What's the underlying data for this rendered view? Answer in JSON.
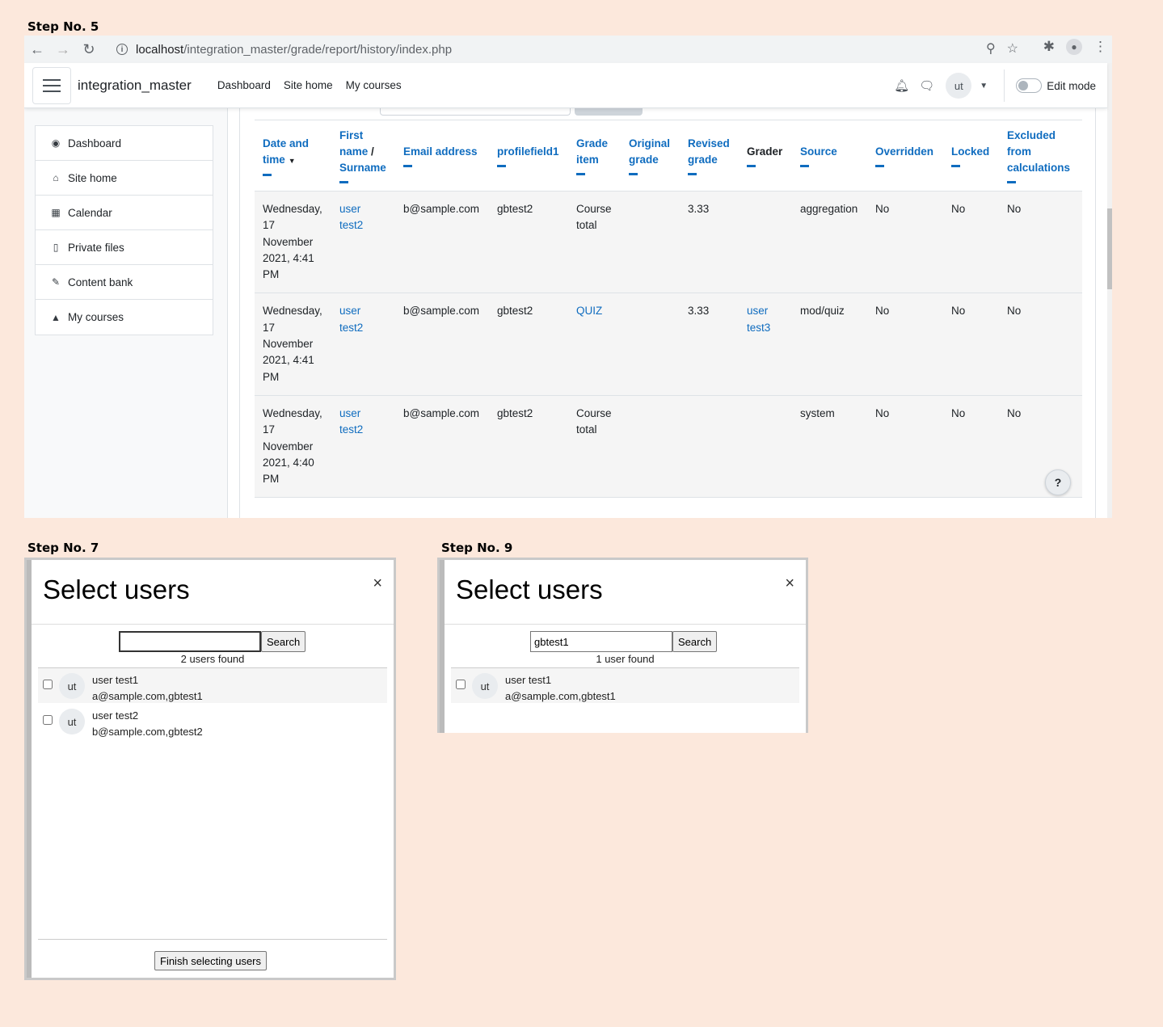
{
  "step5": {
    "label": "Step No. 5",
    "url_host": "localhost",
    "url_path": "/integration_master/grade/report/history/index.php",
    "site_name": "integration_master",
    "primary_nav": [
      "Dashboard",
      "Site home",
      "My courses"
    ],
    "user_initials": "ut",
    "edit_mode_label": "Edit mode",
    "drawer": [
      {
        "label": "Dashboard",
        "icon": "dashboard-icon"
      },
      {
        "label": "Site home",
        "icon": "home-icon"
      },
      {
        "label": "Calendar",
        "icon": "calendar-icon"
      },
      {
        "label": "Private files",
        "icon": "file-icon"
      },
      {
        "label": "Content bank",
        "icon": "paintbrush-icon"
      },
      {
        "label": "My courses",
        "icon": "graduation-cap-icon"
      }
    ],
    "table": {
      "headers": {
        "date": [
          "Date and",
          "time"
        ],
        "name_first": "First",
        "name_name": "name",
        "name_sep": "/",
        "name_surname": "Surname",
        "email": "Email address",
        "profile": "profilefield1",
        "grade_item": [
          "Grade",
          "item"
        ],
        "original": [
          "Original",
          "grade"
        ],
        "revised": [
          "Revised",
          "grade"
        ],
        "grader": "Grader",
        "source": "Source",
        "overridden": "Overridden",
        "locked": "Locked",
        "excluded": [
          "Excluded",
          "from",
          "calculations"
        ]
      },
      "rows": [
        {
          "date": [
            "Wednesday,",
            "17",
            "November",
            "2021, 4:41",
            "PM"
          ],
          "name": [
            "user",
            "test2"
          ],
          "email": "b@sample.com",
          "profile": "gbtest2",
          "item": [
            "Course",
            "total"
          ],
          "item_link": false,
          "original": "",
          "revised": "3.33",
          "grader": [
            "",
            ""
          ],
          "source": "aggregation",
          "overridden": "No",
          "locked": "No",
          "excluded": "No"
        },
        {
          "date": [
            "Wednesday,",
            "17",
            "November",
            "2021, 4:41",
            "PM"
          ],
          "name": [
            "user",
            "test2"
          ],
          "email": "b@sample.com",
          "profile": "gbtest2",
          "item": [
            "QUIZ",
            ""
          ],
          "item_link": true,
          "original": "",
          "revised": "3.33",
          "grader": [
            "user",
            "test3"
          ],
          "source": "mod/quiz",
          "overridden": "No",
          "locked": "No",
          "excluded": "No"
        },
        {
          "date": [
            "Wednesday,",
            "17",
            "November",
            "2021, 4:40",
            "PM"
          ],
          "name": [
            "user",
            "test2"
          ],
          "email": "b@sample.com",
          "profile": "gbtest2",
          "item": [
            "Course",
            "total"
          ],
          "item_link": false,
          "original": "",
          "revised": "",
          "grader": [
            "",
            ""
          ],
          "source": "system",
          "overridden": "No",
          "locked": "No",
          "excluded": "No"
        }
      ]
    },
    "help_label": "?"
  },
  "step7": {
    "label": "Step No. 7",
    "title": "Select users",
    "close": "×",
    "search_value": "",
    "search_button": "Search",
    "found": "2 users found",
    "users": [
      {
        "initials": "ut",
        "name": "user test1",
        "details": "a@sample.com,gbtest1"
      },
      {
        "initials": "ut",
        "name": "user test2",
        "details": "b@sample.com,gbtest2"
      }
    ],
    "finish_button": "Finish selecting users"
  },
  "step9": {
    "label": "Step No. 9",
    "title": "Select users",
    "close": "×",
    "search_value": "gbtest1",
    "search_button": "Search",
    "found": "1 user found",
    "users": [
      {
        "initials": "ut",
        "name": "user test1",
        "details": "a@sample.com,gbtest1"
      }
    ]
  }
}
